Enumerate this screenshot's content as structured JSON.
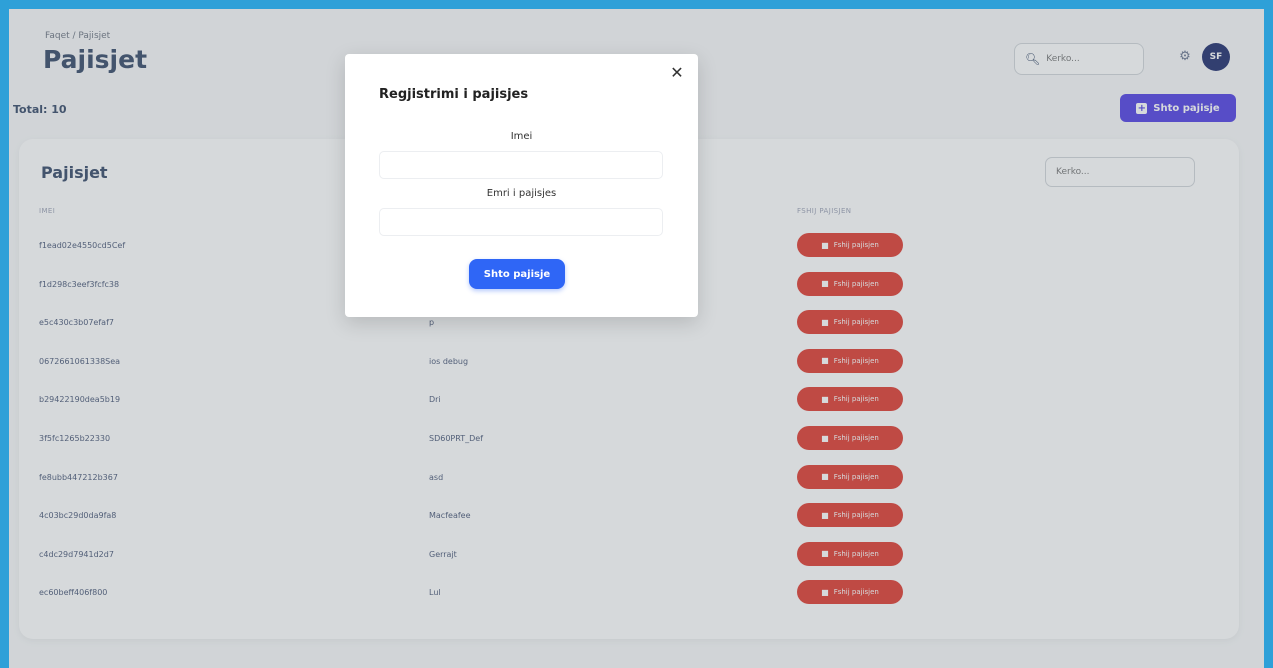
{
  "header": {
    "breadcrumb": "Faqet / Pajisjet",
    "title": "Pajisjet",
    "total": "Total: 10",
    "search_placeholder": "Kerko...",
    "avatar": "SF",
    "add_button": "Shto pajisje"
  },
  "card": {
    "title": "Pajisjet",
    "search_placeholder": "Kerko...",
    "columns": [
      "IMEI",
      "",
      "Fshij pajisjen"
    ]
  },
  "rows": [
    {
      "imei": "f1ead02e4550cd5Cef",
      "name": "",
      "action": "Fshij pajisjen"
    },
    {
      "imei": "f1d298c3eef3fcfc38",
      "name": "",
      "action": "Fshij pajisjen"
    },
    {
      "imei": "e5c430c3b07efaf7",
      "name": "p",
      "action": "Fshij pajisjen"
    },
    {
      "imei": "0672661061338Sea",
      "name": "ios debug",
      "action": "Fshij pajisjen"
    },
    {
      "imei": "b29422190dea5b19",
      "name": "Dri",
      "action": "Fshij pajisjen"
    },
    {
      "imei": "3f5fc1265b22330",
      "name": "SD60PRT_Def",
      "action": "Fshij pajisjen"
    },
    {
      "imei": "fe8ubb447212b367",
      "name": "asd",
      "action": "Fshij pajisjen"
    },
    {
      "imei": "4c03bc29d0da9fa8",
      "name": "Macfeafee",
      "action": "Fshij pajisjen"
    },
    {
      "imei": "c4dc29d7941d2d7",
      "name": "Gerrajt",
      "action": "Fshij pajisjen"
    },
    {
      "imei": "ec60beff406f800",
      "name": "Lul",
      "action": "Fshij pajisjen"
    }
  ],
  "modal": {
    "title": "Regjistrimi i pajisjes",
    "imei_label": "Imei",
    "name_label": "Emri i pajisjes",
    "submit": "Shto pajisje",
    "imei_value": "",
    "name_value": ""
  },
  "colors": {
    "frame": "#2ea0d8",
    "primary": "#4f3ee4",
    "danger": "#e03a2f",
    "submit": "#2f66f6"
  },
  "icons": {
    "search": "search-icon",
    "settings": "gear-icon",
    "close": "close-icon",
    "add": "plus-icon",
    "delete": "trash-icon"
  }
}
